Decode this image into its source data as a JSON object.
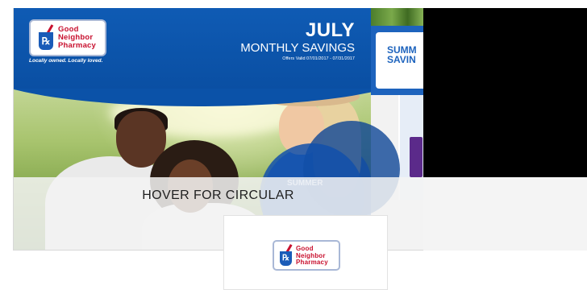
{
  "flyer": {
    "brand": {
      "name_lines": [
        "Good",
        "Neighbor",
        "Pharmacy"
      ],
      "rx_symbol": "℞",
      "tagline": "Locally owned. Locally loved."
    },
    "month": "JULY",
    "headline": "MONTHLY SAVINGS",
    "offers_valid": "Offers Valid 07/01/2017 - 07/31/2017",
    "page2": {
      "title_lines": [
        "SUMM",
        "SAVIN"
      ]
    },
    "overlap_text": "SUMMER"
  },
  "hover": {
    "label": "HOVER FOR CIRCULAR"
  },
  "footer_logo": {
    "name_lines": [
      "Good",
      "Neighbor",
      "Pharmacy"
    ],
    "rx_symbol": "℞"
  },
  "colors": {
    "brand_blue": "#0f5bb4",
    "brand_red": "#c8102e"
  }
}
